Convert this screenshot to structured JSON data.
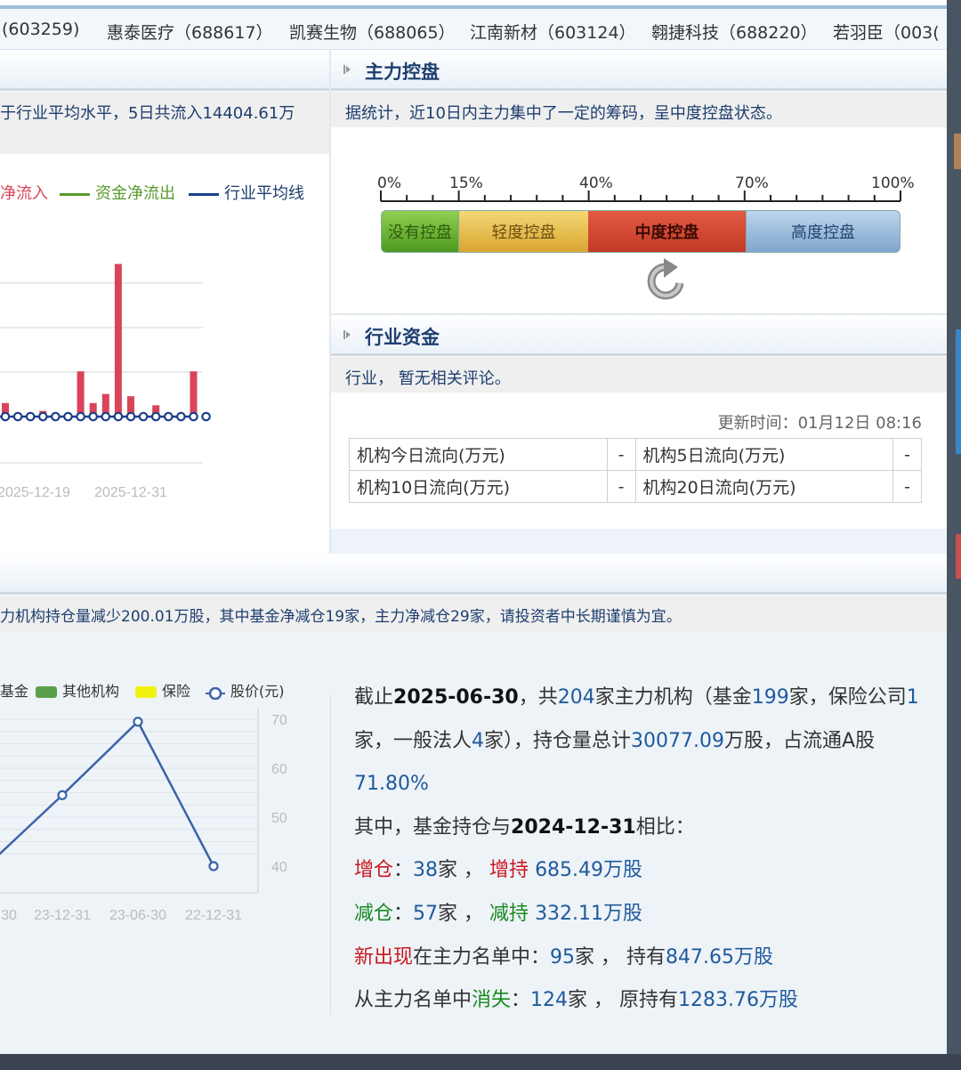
{
  "stock_bar": [
    {
      "text": "(603259)"
    },
    {
      "text": "惠泰医疗（688617）"
    },
    {
      "text": "凯赛生物（688065）"
    },
    {
      "text": "江南新材（603124）"
    },
    {
      "text": "翱捷科技（688220）"
    },
    {
      "text": "若羽臣（003("
    }
  ],
  "capital_flow": {
    "desc": "于行业平均水平，5日共流入14404.61万",
    "legend": [
      "净流入",
      "资金净流出",
      "行业平均线"
    ],
    "x_ticks": [
      "2025-12-19",
      "2025-12-31"
    ]
  },
  "control": {
    "title": "主力控盘",
    "desc": "据统计，近10日内主力集中了一定的筹码，呈中度控盘状态。",
    "ticks": [
      "0%",
      "15%",
      "40%",
      "70%",
      "100%"
    ],
    "segments": [
      "没有控盘",
      "轻度控盘",
      "中度控盘",
      "高度控盘"
    ],
    "level": "中度控盘"
  },
  "industry": {
    "title": "行业资金",
    "desc": "行业， 暂无相关评论。",
    "update_label": "更新时间：01月12日 08:16",
    "table": [
      [
        "机构今日流向(万元)",
        "-",
        "机构5日流向(万元)",
        "-"
      ],
      [
        "机构10日流向(万元)",
        "-",
        "机构20日流向(万元)",
        "-"
      ]
    ]
  },
  "holding": {
    "desc": "力机构持仓量减少200.01万股，其中基金净减仓19家，主力净减仓29家，请投资者中长期谨慎为宜。",
    "legend": [
      "基金",
      "其他机构",
      "保险",
      "股价(元)"
    ],
    "summary": {
      "l1a": "截止",
      "date1": "2025-06-30",
      "l1b": "，共",
      "n_total": "204",
      "l1c": "家主力机构（基金",
      "n_fund": "199",
      "l1d": "家，保险公司",
      "n_ins": "1",
      "l2a": "家，一般法人",
      "n_corp": "4",
      "l2b": "家），持仓量总计",
      "total_shares": "30077.09",
      "l2c": "万股，占流通A股",
      "pct": "71.80%",
      "l4a": "其中，基金持仓与",
      "date2": "2024-12-31",
      "l4b": "相比：",
      "inc_label": "增仓",
      "inc_count": "38",
      "unit_jia": "家",
      "inc_hold_label": "增持",
      "inc_shares": "685.49",
      "unit_wangu": "万股",
      "dec_label": "减仓",
      "dec_count": "57",
      "dec_hold_label": "减持",
      "dec_shares": "332.11",
      "new_label": "新出现",
      "new_mid": "在主力名单中：",
      "new_count": "95",
      "new_hold": "家 ， 持有",
      "new_shares": "847.65",
      "gone_a": "从主力名单中",
      "gone_label": "消失",
      "gone_count": "124",
      "gone_hold": "家 ， 原持有",
      "gone_shares": "1283.76"
    }
  },
  "chart_data": [
    {
      "type": "bar",
      "categories": [
        "",
        "",
        "",
        "",
        "",
        "",
        "",
        "",
        "",
        "",
        "",
        "",
        "",
        "",
        "",
        "",
        ""
      ],
      "x_tick_labels": [
        "2025-12-19",
        "2025-12-31"
      ],
      "series": [
        {
          "name": "净流入",
          "values": [
            12,
            0,
            0,
            5,
            0,
            0,
            40,
            12,
            20,
            135,
            18,
            0,
            10,
            0,
            0,
            40,
            0
          ]
        }
      ],
      "colors": {
        "bar": "#d9445a",
        "avg": "#1b3f8c"
      }
    },
    {
      "type": "line",
      "x": [
        "30",
        "23-12-31",
        "23-06-30",
        "22-12-31"
      ],
      "series": [
        {
          "name": "股价(元)",
          "values": [
            40,
            54.5,
            69.5,
            40
          ]
        }
      ],
      "ylim": [
        40,
        70
      ],
      "y_ticks": [
        40,
        50,
        60,
        70
      ],
      "colors": {
        "line": "#3b63a8"
      }
    }
  ],
  "colors": {
    "accent": "#1e3e6e",
    "red": "#c8181e",
    "green": "#168a1e",
    "blue": "#1e5a9c"
  }
}
